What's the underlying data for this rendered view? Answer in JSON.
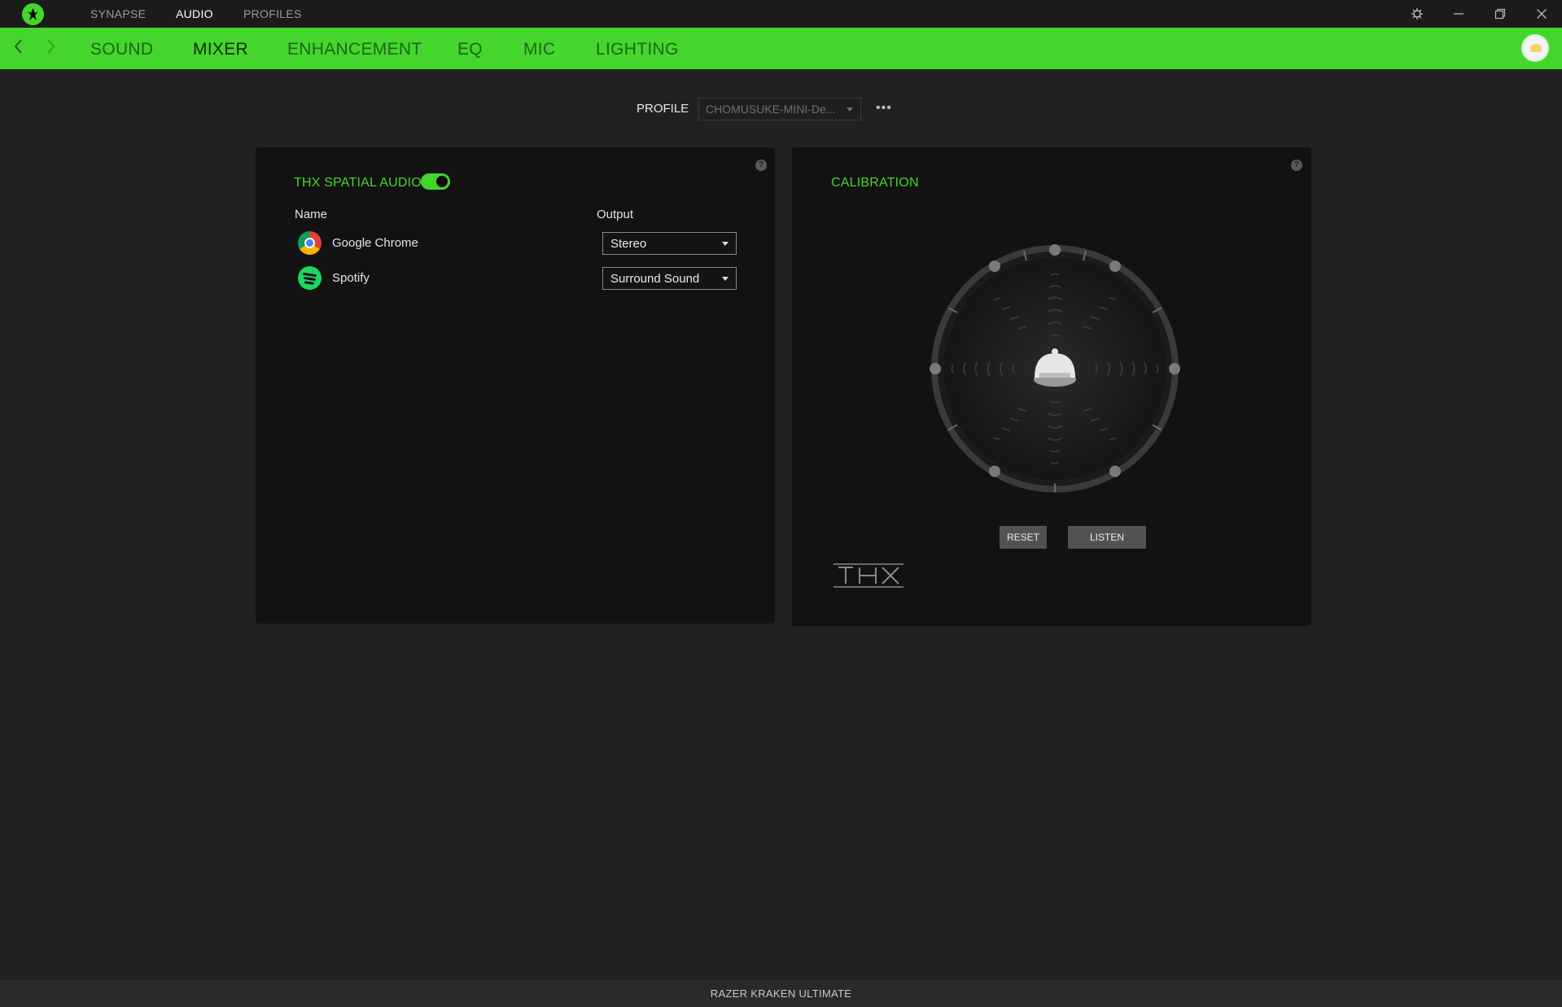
{
  "titlebar": {
    "tabs": [
      {
        "label": "SYNAPSE",
        "active": false
      },
      {
        "label": "AUDIO",
        "active": true
      },
      {
        "label": "PROFILES",
        "active": false
      }
    ],
    "icons": [
      "razer-logo-icon",
      "settings-gear-icon",
      "minimize-icon",
      "restore-icon",
      "close-icon"
    ]
  },
  "subnav": {
    "tabs": [
      {
        "label": "SOUND",
        "active": false
      },
      {
        "label": "MIXER",
        "active": true
      },
      {
        "label": "ENHANCEMENT",
        "active": false
      },
      {
        "label": "EQ",
        "active": false
      },
      {
        "label": "MIC",
        "active": false
      },
      {
        "label": "LIGHTING",
        "active": false
      }
    ],
    "back_icon": "chevron-left-icon",
    "forward_icon": "chevron-right-icon"
  },
  "profile": {
    "label": "PROFILE",
    "value": "CHOMUSUKE-MINI-De...",
    "more": "•••"
  },
  "mixer": {
    "title": "THX SPATIAL AUDIO",
    "thx_enabled": true,
    "columns": {
      "name": "Name",
      "output": "Output"
    },
    "apps": [
      {
        "name": "Google Chrome",
        "output": "Stereo",
        "icon": "chrome-icon"
      },
      {
        "name": "Spotify",
        "output": "Surround Sound",
        "icon": "spotify-icon"
      }
    ],
    "help": "?"
  },
  "calibration": {
    "title": "CALIBRATION",
    "reset_label": "RESET",
    "listen_label": "LISTEN",
    "logo_text": "THX",
    "help": "?"
  },
  "footer": {
    "device": "RAZER KRAKEN ULTIMATE"
  },
  "colors": {
    "accent": "#44d62c",
    "background": "#212121",
    "panel": "#121212",
    "titlebar": "#1b1b1b"
  }
}
